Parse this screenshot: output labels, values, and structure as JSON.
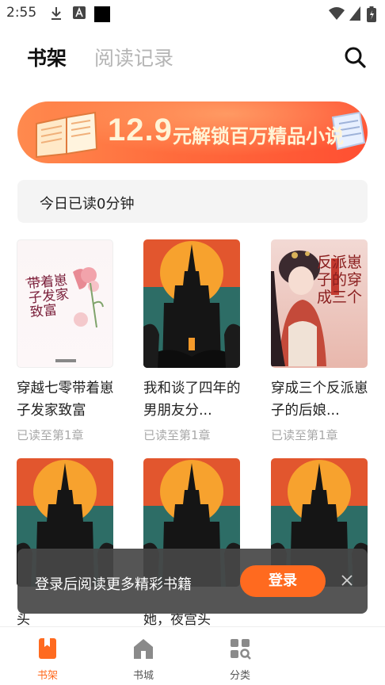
{
  "status_bar": {
    "time": "2:55"
  },
  "header": {
    "tabs": [
      {
        "label": "书架",
        "active": true
      },
      {
        "label": "阅读记录",
        "active": false
      }
    ]
  },
  "banner": {
    "price": "12.9",
    "text": "元解锁百万精品小说"
  },
  "reading": {
    "today": "今日已读0分钟"
  },
  "books": [
    {
      "title": "穿越七零带着崽子发家致富",
      "progress": "已读至第1章",
      "cover": "pink"
    },
    {
      "title": "我和谈了四年的男朋友分...",
      "progress": "已读至第1章",
      "cover": "castle"
    },
    {
      "title": "穿成三个反派崽子的后娘...",
      "progress": "已读至第1章",
      "cover": "ancient"
    },
    {
      "title": "",
      "progress": "",
      "cover": "castle"
    },
    {
      "title": "",
      "progress": "",
      "cover": "castle"
    },
    {
      "title": "",
      "progress": "",
      "cover": "castle"
    }
  ],
  "cover_text": {
    "pink_title": "带着崽子发家致富",
    "ancient_title": "反派崽子的穿成三个"
  },
  "login_prompt": {
    "text": "登录后阅读更多精彩书籍",
    "button": "登录"
  },
  "peek": {
    "left": "头",
    "middle": "她，夜宫头"
  },
  "bottom_nav": [
    {
      "label": "书架",
      "active": true,
      "icon": "bookshelf-icon"
    },
    {
      "label": "书城",
      "active": false,
      "icon": "home-icon"
    },
    {
      "label": "分类",
      "active": false,
      "icon": "category-icon"
    }
  ],
  "colors": {
    "accent": "#ff6a1f",
    "banner": "#ff5a36",
    "text": "#222222",
    "muted": "#a8a8a8"
  }
}
